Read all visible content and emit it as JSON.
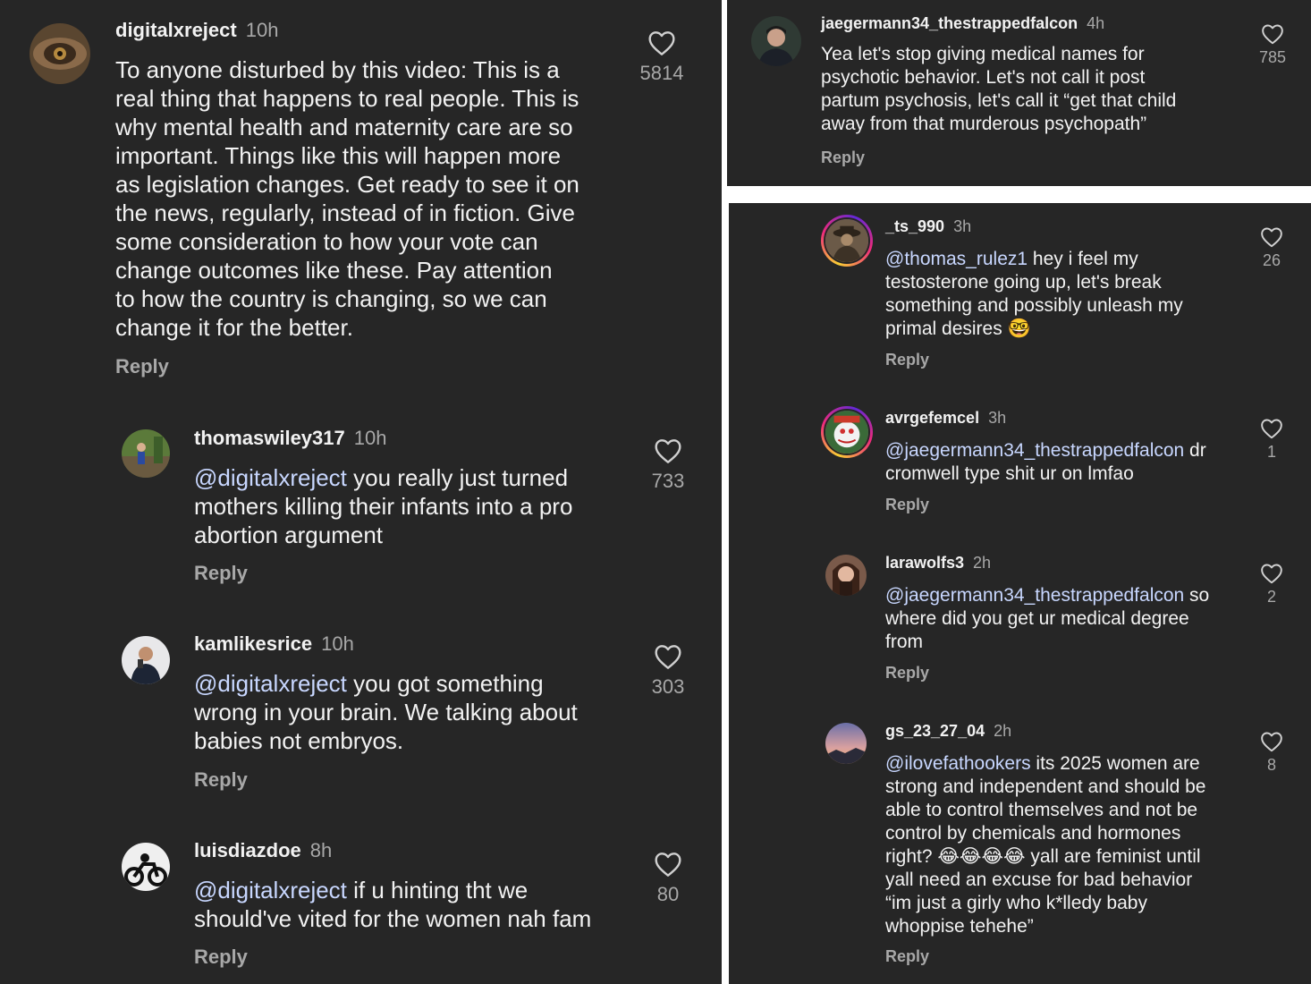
{
  "left": {
    "c1": {
      "user": "digitalxreject",
      "time": "10h",
      "text": "To anyone disturbed by this video: This is a\nreal thing that happens to real people. This is\nwhy mental health and maternity care are so\nimportant. Things like this will happen more\nas legislation changes. Get ready to see it on\nthe news, regularly, instead of in fiction. Give\nsome consideration to how your vote can\nchange outcomes like these. Pay attention\nto how the country is changing, so we can\nchange it for the better.",
      "reply": "Reply",
      "likes": "5814",
      "icon": "heart-icon"
    },
    "c2": {
      "user": "thomaswiley317",
      "time": "10h",
      "mention": "@digitalxreject",
      "text": " you really just turned\nmothers killing their infants into a pro\nabortion argument",
      "reply": "Reply",
      "likes": "733"
    },
    "c3": {
      "user": "kamlikesrice",
      "time": "10h",
      "mention": "@digitalxreject",
      "text": " you got something\nwrong in your brain. We talking about\nbabies not embryos.",
      "reply": "Reply",
      "likes": "303"
    },
    "c4": {
      "user": "luisdiazdoe",
      "time": "8h",
      "mention": "@digitalxreject",
      "text": " if u hinting tht we\nshould've vited for the women nah fam",
      "reply": "Reply",
      "likes": "80"
    }
  },
  "top_right": {
    "c1": {
      "user": "jaegermann34_thestrappedfalcon",
      "time": "4h",
      "text": "Yea let's stop giving medical names for\npsychotic behavior. Let's not call it post\npartum psychosis, let's call it “get that child\naway from that murderous psychopath”",
      "reply": "Reply",
      "likes": "785"
    }
  },
  "bottom_right": {
    "c1": {
      "user": "_ts_990",
      "time": "3h",
      "mention": "@thomas_rulez1",
      "text": " hey i feel my\ntestosterone going up, let's break\nsomething and possibly unleash my\nprimal desires 🤓",
      "reply": "Reply",
      "likes": "26"
    },
    "c2": {
      "user": "avrgefemcel",
      "time": "3h",
      "mention": "@jaegermann34_thestrappedfalcon",
      "text": " dr\ncromwell type shit ur on lmfao",
      "reply": "Reply",
      "likes": "1"
    },
    "c3": {
      "user": "larawolfs3",
      "time": "2h",
      "mention": "@jaegermann34_thestrappedfalcon",
      "text": " so\nwhere did you get ur medical degree\nfrom",
      "reply": "Reply",
      "likes": "2"
    },
    "c4": {
      "user": "gs_23_27_04",
      "time": "2h",
      "mention": "@ilovefathookers",
      "text": " its 2025 women are\nstrong and independent and should be\nable to control themselves and not be\ncontrol by chemicals and hormones\nright? 😂😂😂😂 yall are feminist until\nyall need an excuse for bad behavior\n“im just a girly who k*lledy baby\nwhoppise tehehe”",
      "reply": "Reply",
      "likes": "8"
    }
  }
}
